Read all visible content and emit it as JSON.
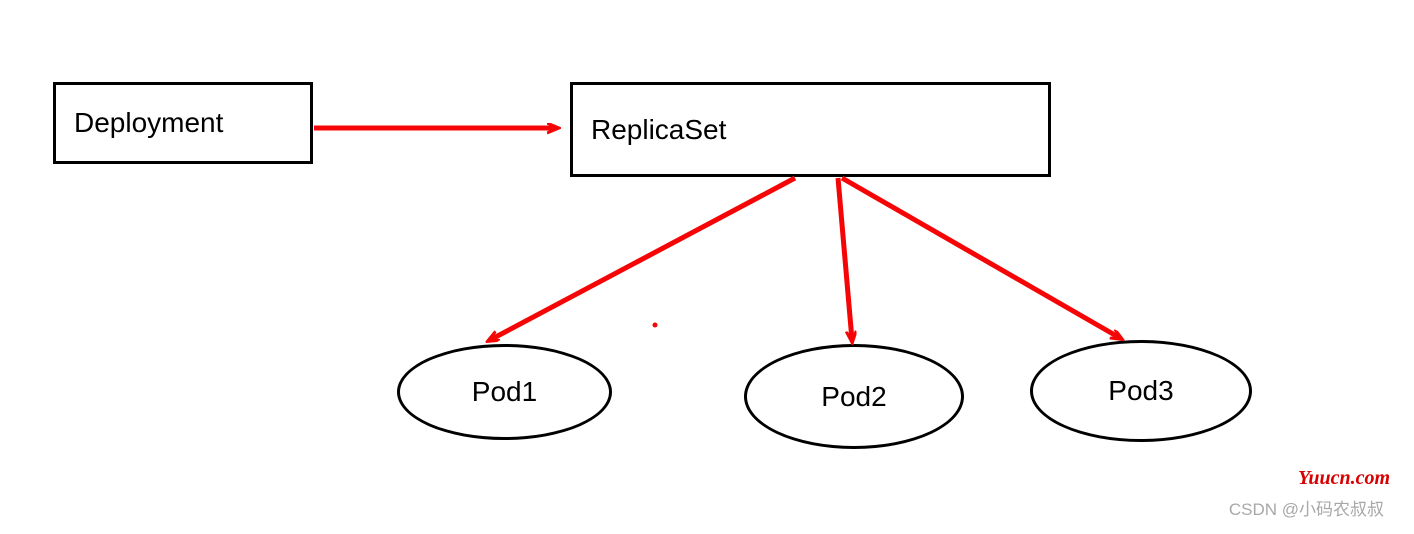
{
  "nodes": {
    "deployment": "Deployment",
    "replicaset": "ReplicaSet",
    "pod1": "Pod1",
    "pod2": "Pod2",
    "pod3": "Pod3"
  },
  "watermarks": {
    "site": "Yuucn.com",
    "author": "CSDN @小码农叔叔"
  },
  "colors": {
    "arrow": "#f50505",
    "border": "#000000"
  }
}
